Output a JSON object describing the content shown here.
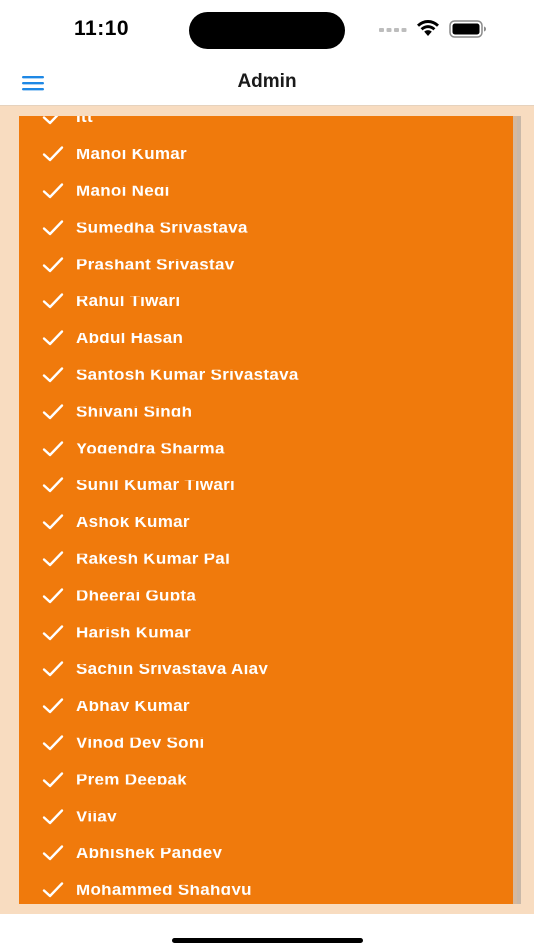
{
  "status_bar": {
    "time": "11:10"
  },
  "nav_bar": {
    "title": "Admin"
  },
  "colors": {
    "accent": "#1e88e5",
    "panel": "#f07a0c",
    "background": "#f8dcc0"
  },
  "list": {
    "items": [
      {
        "label": "Itt"
      },
      {
        "label": "Manoj Kumar"
      },
      {
        "label": "Manoj Negi"
      },
      {
        "label": "Sumedha Srivastava"
      },
      {
        "label": "Prashant Srivastav"
      },
      {
        "label": "Rahul Tiwari"
      },
      {
        "label": "Abdul Hasan"
      },
      {
        "label": "Santosh Kumar Srivastava"
      },
      {
        "label": "Shivani Singh"
      },
      {
        "label": "Yogendra Sharma"
      },
      {
        "label": "Sunil Kumar Tiwari"
      },
      {
        "label": "Ashok Kumar"
      },
      {
        "label": "Rakesh Kumar Pal"
      },
      {
        "label": "Dheeraj Gupta"
      },
      {
        "label": "Harish Kumar"
      },
      {
        "label": "Sachin Srivastava Ajay"
      },
      {
        "label": "Abhay Kumar"
      },
      {
        "label": "Vinod Dev Soni"
      },
      {
        "label": "Prem Deepak"
      },
      {
        "label": "Vijay"
      },
      {
        "label": "Abhishek Pandey"
      },
      {
        "label": "Mohammed Shahgyu"
      }
    ]
  }
}
